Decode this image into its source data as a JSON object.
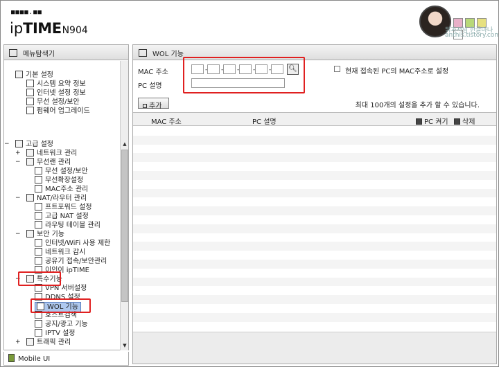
{
  "header": {
    "logo_dots": "■■■■.■■",
    "brand_ip": "ip",
    "brand_time": "TIME",
    "model": "N904",
    "watermark_line1": "뒤과서님 한글마나",
    "watermark_line2": "anthis.tistory.com"
  },
  "sidebar": {
    "title": "메뉴탐색기",
    "basic": {
      "label": "기본 설정",
      "items": [
        "시스템 요약 정보",
        "인터넷 설정 정보",
        "무선 설정/보안",
        "펌웨어 업그레이드"
      ]
    },
    "advanced": {
      "label": "고급 설정",
      "network": "네트워크 관리",
      "wireless": "무선랜 관리",
      "wireless_items": [
        "무선 설정/보안",
        "무선확장설정",
        "MAC주소 관리"
      ],
      "nat": "NAT/라우터 관리",
      "nat_items": [
        "프트포워드 설정",
        "고급 NAT 설정",
        "라우팅 테이블 관리"
      ],
      "security": "보안 기능",
      "security_items": [
        "인터넷/WiFi 사용 제한",
        "네트워크 감시",
        "공유기 접속/보안관리",
        "이인이 ipTIME"
      ],
      "special": "특수기능",
      "special_items": [
        "VPN 서버설정",
        "DDNS 설정",
        "WOL 기능",
        "호스트검색",
        "공지/광고 기능",
        "IPTV 설정"
      ],
      "traffic": "트래픽 관리"
    },
    "mobile": "Mobile UI"
  },
  "main": {
    "title": "WOL 기능",
    "mac_label": "MAC 주소",
    "desc_label": "PC 설명",
    "mac_values": [
      "",
      "",
      "",
      "",
      "",
      ""
    ],
    "mac_separator": "-",
    "search_icon": "magnifier-icon",
    "current_pc_label": "현재 접속된 PC의 MAC주소로 설정",
    "add_label": "추가",
    "max_note": "최대 100개의 설정을 추가 할 수 있습니다.",
    "table": {
      "col_mac": "MAC 주소",
      "col_desc": "PC 설명",
      "col_wake": "PC 켜기",
      "col_delete": "삭제",
      "rows": []
    }
  }
}
